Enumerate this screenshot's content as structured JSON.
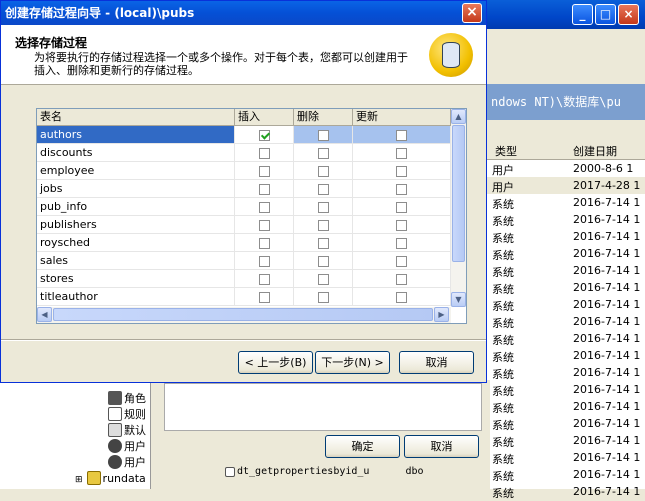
{
  "background": {
    "title_buttons": [
      "_",
      "□",
      "×"
    ],
    "path_text": "ndows NT)\\数据库\\pu",
    "list_headers": [
      "类型",
      "创建日期"
    ],
    "list_rows": [
      {
        "type": "用户",
        "date": "2000-8-6 1"
      },
      {
        "type": "用户",
        "date": "2017-4-28 1"
      },
      {
        "type": "系统",
        "date": "2016-7-14 1"
      },
      {
        "type": "系统",
        "date": "2016-7-14 1"
      },
      {
        "type": "系统",
        "date": "2016-7-14 1"
      },
      {
        "type": "系统",
        "date": "2016-7-14 1"
      },
      {
        "type": "系统",
        "date": "2016-7-14 1"
      },
      {
        "type": "系统",
        "date": "2016-7-14 1"
      },
      {
        "type": "系统",
        "date": "2016-7-14 1"
      },
      {
        "type": "系统",
        "date": "2016-7-14 1"
      },
      {
        "type": "系统",
        "date": "2016-7-14 1"
      },
      {
        "type": "系统",
        "date": "2016-7-14 1"
      },
      {
        "type": "系统",
        "date": "2016-7-14 1"
      },
      {
        "type": "系统",
        "date": "2016-7-14 1"
      },
      {
        "type": "系统",
        "date": "2016-7-14 1"
      },
      {
        "type": "系统",
        "date": "2016-7-14 1"
      },
      {
        "type": "系统",
        "date": "2016-7-14 1"
      },
      {
        "type": "系统",
        "date": "2016-7-14 1"
      },
      {
        "type": "系统",
        "date": "2016-7-14 1"
      },
      {
        "type": "系统",
        "date": "2016-7-14 1"
      }
    ],
    "tree_items": [
      "角色",
      "规则",
      "默认",
      "用户",
      "用户",
      "rundata"
    ],
    "sp_name": "dt_getpropertiesbyid_u",
    "sp_owner": "dbo",
    "ok_label": "确定",
    "cancel_label": "取消"
  },
  "wizard": {
    "title": "创建存储过程向导 - (local)\\pubs",
    "close_glyph": "×",
    "header_title": "选择存储过程",
    "header_desc": "为将要执行的存储过程选择一个或多个操作。对于每个表，您都可以创建用于插入、删除和更新行的存储过程。",
    "columns": [
      "表名",
      "插入",
      "删除",
      "更新"
    ],
    "rows": [
      {
        "name": "authors",
        "insert": true,
        "delete": false,
        "update": false,
        "selected": true
      },
      {
        "name": "discounts",
        "insert": false,
        "delete": false,
        "update": false
      },
      {
        "name": "employee",
        "insert": false,
        "delete": false,
        "update": false
      },
      {
        "name": "jobs",
        "insert": false,
        "delete": false,
        "update": false
      },
      {
        "name": "pub_info",
        "insert": false,
        "delete": false,
        "update": false
      },
      {
        "name": "publishers",
        "insert": false,
        "delete": false,
        "update": false
      },
      {
        "name": "roysched",
        "insert": false,
        "delete": false,
        "update": false
      },
      {
        "name": "sales",
        "insert": false,
        "delete": false,
        "update": false
      },
      {
        "name": "stores",
        "insert": false,
        "delete": false,
        "update": false
      },
      {
        "name": "titleauthor",
        "insert": false,
        "delete": false,
        "update": false
      }
    ],
    "back_label": "< 上一步(B)",
    "next_label": "下一步(N) >",
    "cancel_label": "取消"
  },
  "colors": {
    "title_blue": "#0550d6",
    "selected_row": "#316ac5",
    "selected_col": "#a6c2ee"
  }
}
